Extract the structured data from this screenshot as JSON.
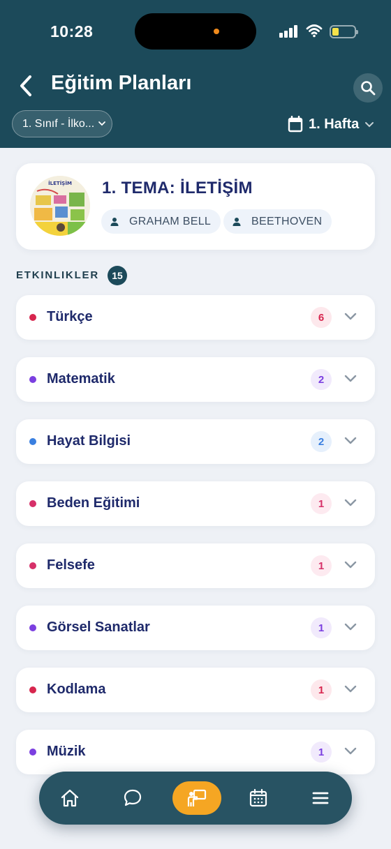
{
  "status_bar": {
    "time": "10:28"
  },
  "header": {
    "title": "Eğitim Planları",
    "grade_filter": "1. Sınıf - İlko...",
    "week_filter": "1. Hafta"
  },
  "theme": {
    "title": "1. TEMA: İLETİŞİM",
    "thumbnail_caption": "İLETİŞİM",
    "people": [
      "GRAHAM BELL",
      "BEETHOVEN"
    ]
  },
  "activities": {
    "label": "ETKINLIKLER",
    "count": "15",
    "subjects": [
      {
        "name": "Türkçe",
        "count": "6",
        "color": "#d7264e",
        "badge_bg": "#fde8ec",
        "badge_fg": "#d7264e"
      },
      {
        "name": "Matematik",
        "count": "2",
        "color": "#7b3fe0",
        "badge_bg": "#f1eafc",
        "badge_fg": "#7b3fe0"
      },
      {
        "name": "Hayat Bilgisi",
        "count": "2",
        "color": "#3a7fe0",
        "badge_bg": "#e6f0fc",
        "badge_fg": "#3a7fe0"
      },
      {
        "name": "Beden Eğitimi",
        "count": "1",
        "color": "#d63069",
        "badge_bg": "#fdeaf0",
        "badge_fg": "#d63069"
      },
      {
        "name": "Felsefe",
        "count": "1",
        "color": "#d63069",
        "badge_bg": "#fdeaf0",
        "badge_fg": "#d63069"
      },
      {
        "name": "Görsel Sanatlar",
        "count": "1",
        "color": "#7b3fe0",
        "badge_bg": "#f1eafc",
        "badge_fg": "#7b3fe0"
      },
      {
        "name": "Kodlama",
        "count": "1",
        "color": "#d7264e",
        "badge_bg": "#fde8ec",
        "badge_fg": "#d7264e"
      },
      {
        "name": "Müzik",
        "count": "1",
        "color": "#7b3fe0",
        "badge_bg": "#f1eafc",
        "badge_fg": "#7b3fe0"
      }
    ]
  },
  "tab_bar": {
    "items": [
      "home-icon",
      "chat-icon",
      "teacher-board-icon",
      "calendar-icon",
      "menu-icon"
    ],
    "active_index": 2,
    "active_color": "#f5a623"
  },
  "colors": {
    "primary": "#1c4a5a",
    "title_text": "#1f2a6b",
    "background": "#eef1f6"
  }
}
